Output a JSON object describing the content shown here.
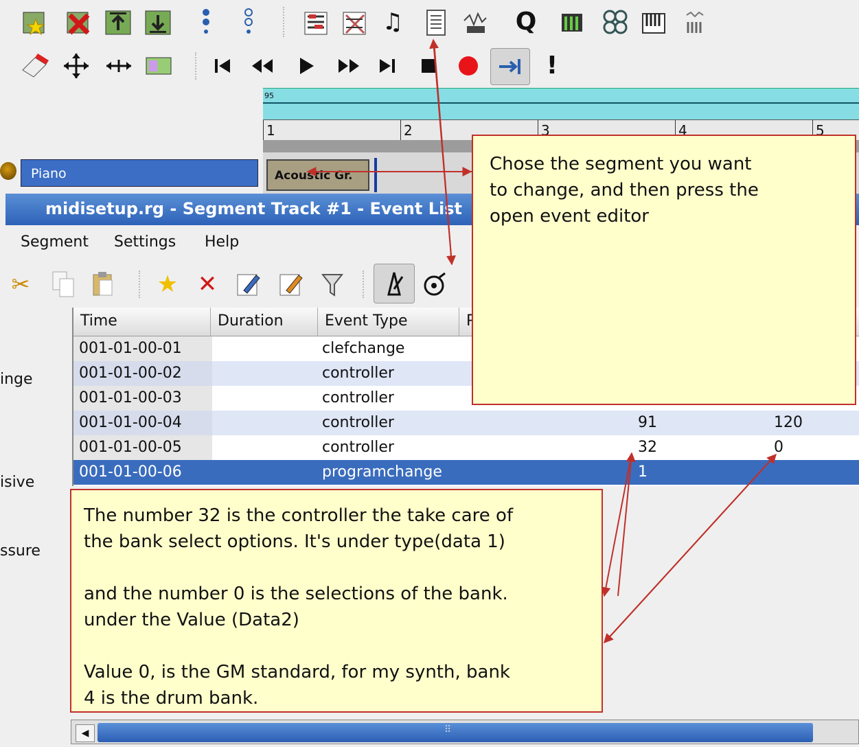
{
  "transport": {
    "record_color": "#e8141a"
  },
  "timeline": {
    "tempo_marker": "95",
    "bars": [
      "1",
      "2",
      "3",
      "4",
      "5"
    ]
  },
  "track": {
    "name": "Piano",
    "segment_label": "Acoustic Gr."
  },
  "window": {
    "title": "midisetup.rg - Segment Track #1 - Event List"
  },
  "menus": [
    "Segment",
    "Settings",
    "Help"
  ],
  "left_panel_fragments": [
    "inge",
    "isive",
    "ssure"
  ],
  "event_list": {
    "columns": [
      "Time",
      "Duration",
      "Event Type",
      "P"
    ],
    "rows": [
      {
        "time": "001-01-00-01",
        "type": "clefchange",
        "data1": "",
        "data2": ""
      },
      {
        "time": "001-01-00-02",
        "type": "controller",
        "data1": "",
        "data2": ""
      },
      {
        "time": "001-01-00-03",
        "type": "controller",
        "data1": "",
        "data2": ""
      },
      {
        "time": "001-01-00-04",
        "type": "controller",
        "data1": "91",
        "data2": "120"
      },
      {
        "time": "001-01-00-05",
        "type": "controller",
        "data1": "32",
        "data2": "0"
      },
      {
        "time": "001-01-00-06",
        "type": "programchange",
        "data1": "1",
        "data2": ""
      }
    ],
    "selected_row": 5
  },
  "annotations": {
    "top": "Chose the segment you want\nto change, and then press the\nopen event editor",
    "bottom": "The number 32 is the controller the take care of\nthe bank select options. It's under type(data 1)\n\nand the number 0 is the selections of the bank.\nunder the Value (Data2)\n\nValue 0, is the GM standard, for my synth, bank\n4 is the drum bank.",
    "border_color": "#c0302a",
    "fill_color": "#ffffcc"
  },
  "colors": {
    "selection": "#3a6cbd",
    "loop_bar": "#86dde4"
  }
}
